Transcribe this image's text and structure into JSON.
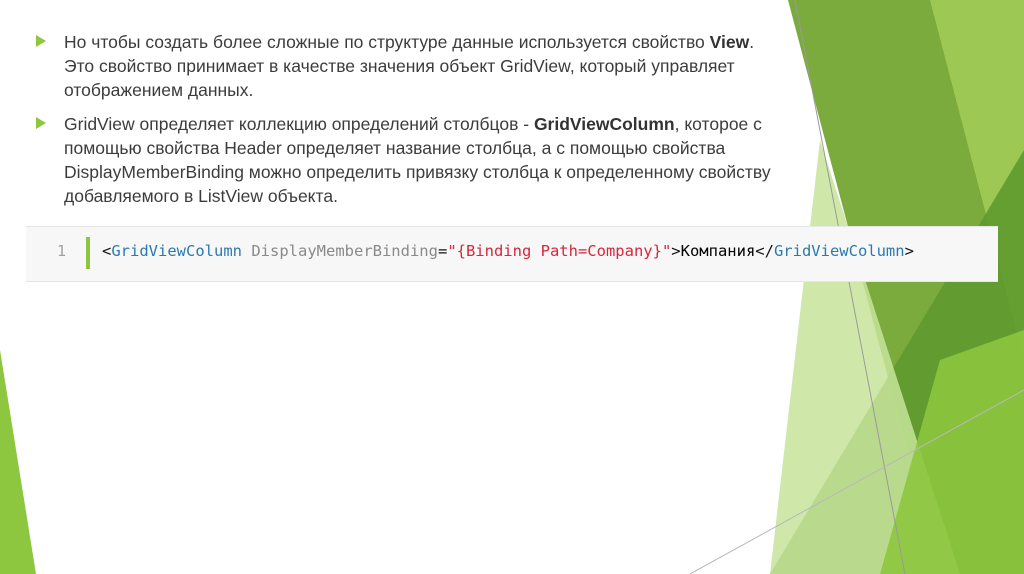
{
  "theme": {
    "accent": "#8dc63f",
    "greens": [
      "#5f8f3a",
      "#79b136",
      "#8dc63f",
      "#a8d45e",
      "#c7e49a",
      "#e3f1cc"
    ]
  },
  "bullets": [
    {
      "icon": "triangle-bullet-icon",
      "parts": [
        {
          "text": "Но чтобы создать более сложные по структуре данные используется свойство ",
          "bold": false
        },
        {
          "text": "View",
          "bold": true
        },
        {
          "text": ". Это свойство принимает в качестве значения объект GridView, который управляет отображением данных.",
          "bold": false
        }
      ]
    },
    {
      "icon": "triangle-bullet-icon",
      "parts": [
        {
          "text": " GridView определяет коллекцию определений столбцов - ",
          "bold": false
        },
        {
          "text": "GridViewColumn",
          "bold": true
        },
        {
          "text": ", которое с помощью свойства Header определяет название столбца, а с помощью свойства DisplayMemberBinding можно определить привязку столбца к определенному свойству добавляемого в ListView объекта.",
          "bold": false
        }
      ]
    }
  ],
  "code": {
    "line_number": "1",
    "tokens": [
      {
        "text": "<",
        "kind": "punct"
      },
      {
        "text": "GridViewColumn",
        "kind": "tag"
      },
      {
        "text": " DisplayMemberBinding",
        "kind": "attr"
      },
      {
        "text": "=",
        "kind": "punct"
      },
      {
        "text": "\"{Binding Path=Company}\"",
        "kind": "val"
      },
      {
        "text": ">",
        "kind": "punct"
      },
      {
        "text": "Компания",
        "kind": "text"
      },
      {
        "text": "</",
        "kind": "punct"
      },
      {
        "text": "GridViewColumn",
        "kind": "tag"
      },
      {
        "text": ">",
        "kind": "punct"
      }
    ]
  }
}
